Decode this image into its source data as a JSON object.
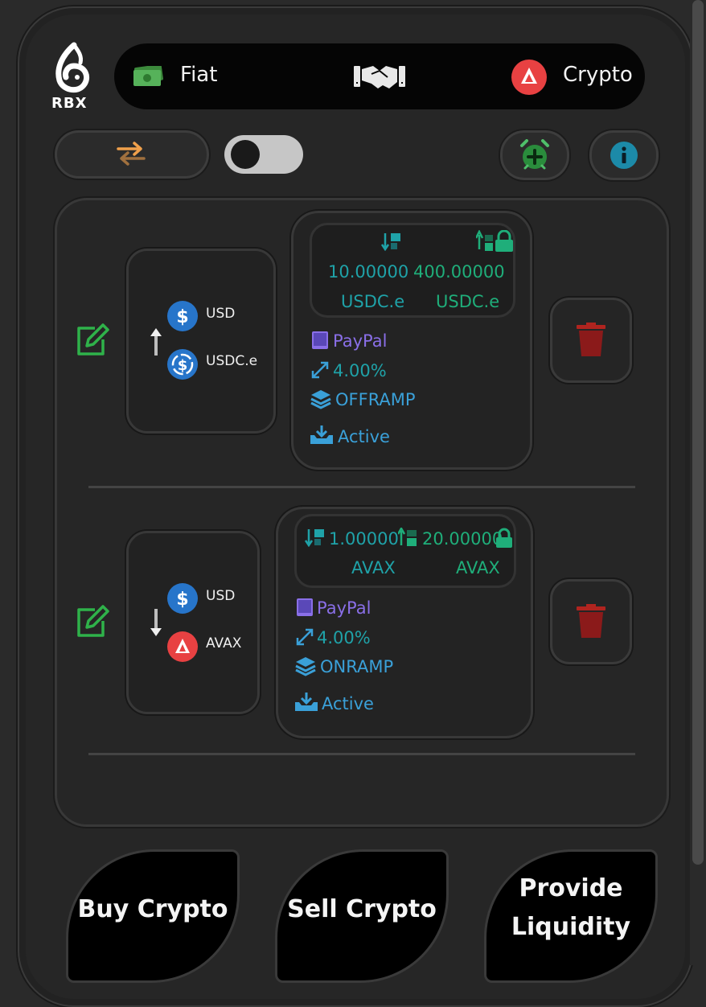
{
  "brand": {
    "logo_text": "RBX"
  },
  "topbar": {
    "fiat_label": "Fiat",
    "crypto_label": "Crypto"
  },
  "offers": [
    {
      "from_currency": "USD",
      "to_currency": "USDC.e",
      "direction": "up",
      "min_amount": "10.00000",
      "min_unit": "USDC.e",
      "max_amount": "400.00000",
      "max_unit": "USDC.e",
      "payment_method": "PayPal",
      "fee": "4.00%",
      "type": "OFFRAMP",
      "status": "Active"
    },
    {
      "from_currency": "USD",
      "to_currency": "AVAX",
      "direction": "down",
      "min_amount": "1.00000",
      "min_unit": "AVAX",
      "max_amount": "20.00000",
      "max_unit": "AVAX",
      "payment_method": "PayPal",
      "fee": "4.00%",
      "type": "ONRAMP",
      "status": "Active"
    }
  ],
  "actions": {
    "buy_label": "Buy Crypto",
    "sell_label": "Sell Crypto",
    "provide_line1": "Provide",
    "provide_line2": "Liquidity"
  },
  "colors": {
    "teal": "#1fa2a8",
    "green": "#1fae7a",
    "purple": "#8a6fe8",
    "avax_red": "#e84142",
    "usd_blue": "#2775ca",
    "edit_green": "#2fb24a",
    "trash_red": "#8b1a1a"
  },
  "icons": [
    "rbx-logo-icon",
    "cash-icon",
    "handshake-icon",
    "avalanche-icon",
    "swap-arrows-icon",
    "alarm-add-icon",
    "info-icon",
    "edit-icon",
    "trash-icon",
    "tablet-icon",
    "expand-icon",
    "layers-icon",
    "download-tray-icon",
    "lock-icon"
  ]
}
